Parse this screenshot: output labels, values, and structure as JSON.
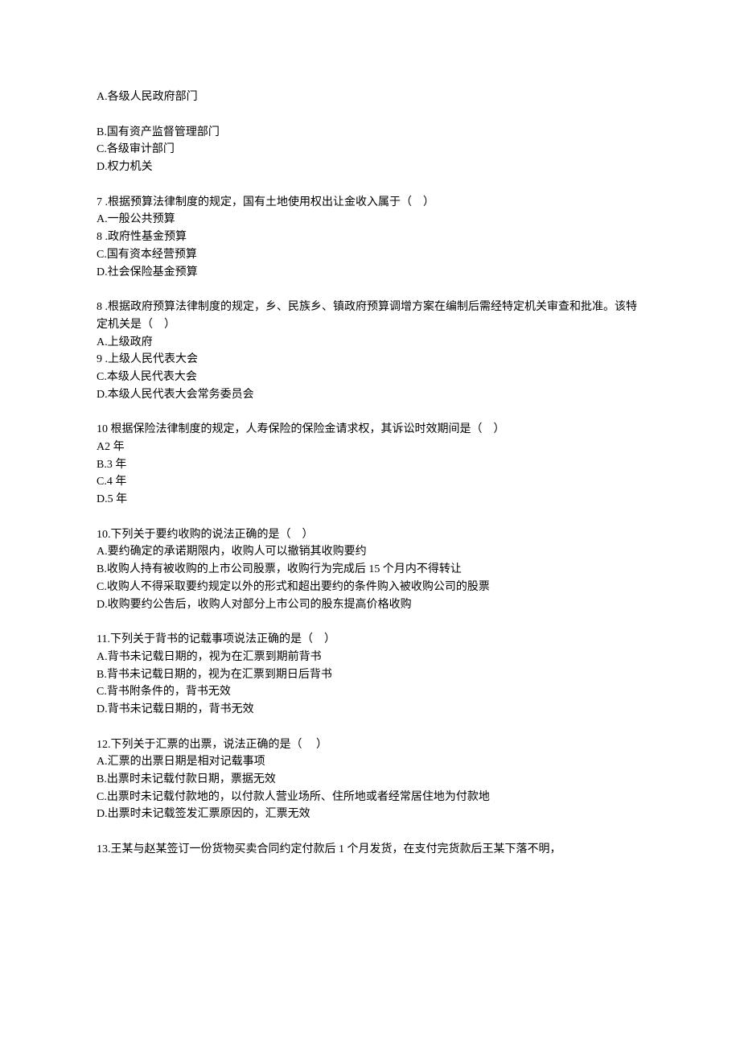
{
  "options_block_a": [
    "A.各级人民政府部门"
  ],
  "options_block_b": [
    "B.国有资产监督管理部门",
    "C.各级审计部门",
    "D.权力机关"
  ],
  "q7": {
    "stem": "7 .根据预算法律制度的规定，国有土地使用权出让金收入属于（    ）",
    "options": [
      "A.一般公共预算",
      "8 .政府性基金预算",
      "C.国有资本经营预算",
      "D.社会保险基金预算"
    ]
  },
  "q8": {
    "stem": "8 .根据政府预算法律制度的规定，乡、民族乡、镇政府预算调增方案在编制后需经特定机关审查和批准。该特定机关是（    ）",
    "options": [
      "A.上级政府",
      "9 .上级人民代表大会",
      "C.本级人民代表大会",
      "D.本级人民代表大会常务委员会"
    ]
  },
  "q9b": {
    "stem": "10 根据保险法律制度的规定，人寿保险的保险金请求权，其诉讼时效期间是（    ）",
    "options": [
      "A2 年",
      "B.3 年",
      "C.4 年",
      "D.5 年"
    ]
  },
  "q10": {
    "stem": "10.下列关于要约收购的说法正确的是（    ）",
    "options": [
      "A.要约确定的承诺期限内，收购人可以撤销其收购要约",
      "B.收购人持有被收购的上市公司股票，收购行为完成后 15 个月内不得转让",
      "C.收购人不得采取要约规定以外的形式和超出要约的条件购入被收购公司的股票",
      "D.收购要约公告后，收购人对部分上市公司的股东提高价格收购"
    ]
  },
  "q11": {
    "stem": "11.下列关于背书的记载事项说法正确的是（    ）",
    "options": [
      "A.背书未记载日期的，视为在汇票到期前背书",
      "B.背书未记载日期的，视为在汇票到期日后背书",
      "C.背书附条件的，背书无效",
      "D.背书未记载日期的，背书无效"
    ]
  },
  "q12": {
    "stem": "12.下列关于汇票的出票，说法正确的是（     ）",
    "options": [
      "A.汇票的出票日期是相对记载事项",
      "B.出票时未记载付款日期，票据无效",
      "C.出票时未记载付款地的，以付款人营业场所、住所地或者经常居住地为付款地",
      "D.出票时未记载签发汇票原因的，汇票无效"
    ]
  },
  "q13": {
    "stem": "13.王某与赵某签订一份货物买卖合同约定付款后 1 个月发货，在支付完货款后王某下落不明，"
  }
}
